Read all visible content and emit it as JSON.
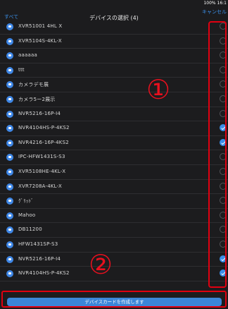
{
  "statusbar": {
    "text": "100% 16:1"
  },
  "header": {
    "back_label": "すべて",
    "title": "デバイスの選択 (4)",
    "cancel_label": "キャンセル"
  },
  "devices": [
    {
      "name": "XVR51001 4HL X",
      "selected": false
    },
    {
      "name": "XVR5104S-4KL-X",
      "selected": false
    },
    {
      "name": "aaaaaa",
      "selected": false
    },
    {
      "name": "ttt",
      "selected": false
    },
    {
      "name": "カメラデモ展",
      "selected": false
    },
    {
      "name": "カメラ5ー2展示",
      "selected": false
    },
    {
      "name": "NVR5216-16P-I4",
      "selected": false
    },
    {
      "name": "NVR4104HS-P-4KS2",
      "selected": true
    },
    {
      "name": "NVR4216-16P-4KS2",
      "selected": true
    },
    {
      "name": "IPC-HFW1431S-S3",
      "selected": false
    },
    {
      "name": "XVR5108HE-4KL-X",
      "selected": false
    },
    {
      "name": "XVR7208A-4KL-X",
      "selected": false
    },
    {
      "name": "ｸﾞﾘｯﾄﾞ",
      "selected": false
    },
    {
      "name": "Mahoo",
      "selected": false
    },
    {
      "name": "DB11200",
      "selected": false
    },
    {
      "name": "HFW1431SP-S3",
      "selected": false
    },
    {
      "name": "NVR5216-16P-I4",
      "selected": true
    },
    {
      "name": "NVR4104HS-P-4KS2",
      "selected": true
    }
  ],
  "annotations": {
    "marker1": "①",
    "marker2": "②"
  },
  "footer": {
    "create_button_label": "デバイスカードを作成します"
  },
  "colors": {
    "accent": "#3b8fe8",
    "highlight": "#e00010",
    "background": "#1c1c1e"
  }
}
